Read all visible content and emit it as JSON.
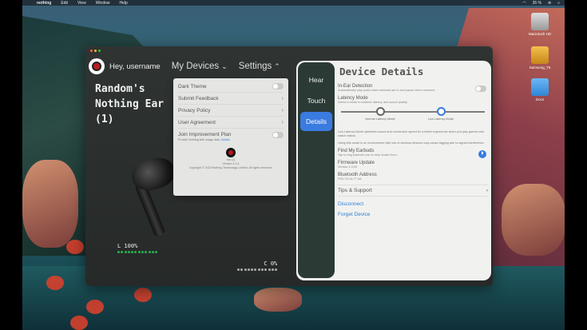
{
  "menubar": {
    "app": "nothing",
    "items": [
      "Edit",
      "View",
      "Window",
      "Help"
    ],
    "battery": "35 %"
  },
  "desktop_icons": [
    "Macintosh HD",
    "Samsung_T5",
    "Docs"
  ],
  "header": {
    "greeting": "Hey, username",
    "nav_devices": "My Devices",
    "nav_settings": "Settings"
  },
  "device": {
    "name": "Random's Nothing Ear (1)",
    "battery_left": "L 100%",
    "battery_left_fraction": 1.0,
    "battery_case": "C 0%",
    "battery_case_fraction": 0.0
  },
  "settings_menu": {
    "items": [
      {
        "label": "Dark Theme",
        "type": "toggle"
      },
      {
        "label": "Submit Feedback",
        "type": "arrow"
      },
      {
        "label": "Privacy Policy",
        "type": "arrow"
      },
      {
        "label": "User Agreement",
        "type": "arrow"
      },
      {
        "label": "Join Improvement Plan",
        "type": "toggle"
      }
    ],
    "improvement_sub": "Provide Nothing with usage data.",
    "improvement_link": "Details",
    "footer_name": "ear (1)",
    "footer_version": "Version 1.0.4",
    "footer_copyright": "Copyright © 2023 Nothing Technology Limited. All rights reserved."
  },
  "details": {
    "tabs": [
      "Hear",
      "Touch",
      "Details"
    ],
    "active_tab": "Details",
    "title": "Device Details",
    "in_ear_label": "In-Ear Detection",
    "in_ear_sub": "Automatically play audio when earbuds are in and pause when removed.",
    "latency_label": "Latency Mode",
    "latency_sub": "Select a mode to balance latency and sound quality.",
    "latency_options": [
      "Normal Latency Mode",
      "Low Latency Mode"
    ],
    "latency_selected": "Low Latency Mode",
    "latency_para1": "Low Latency Mode optimises sound and connection speed for a better experience when you play games and watch videos.",
    "latency_para2": "Using this mode in an environment with lots of wireless devices may cause lagging due to signal interference.",
    "find_label": "Find My Earbuds",
    "find_sub": "Tap to ring earbuds now to help locate them.",
    "firmware_label": "Firmware Update",
    "firmware_sub": "Version 1.0.52",
    "bt_label": "Bluetooth Address",
    "bt_sub": "FD0:7A:1A:77 AA",
    "tips_label": "Tips & Support",
    "disconnect": "Disconnect",
    "forget": "Forget Device"
  },
  "colors": {
    "accent": "#3a7be0",
    "battery_green": "#25b34b",
    "brand_red": "#c0171c"
  }
}
